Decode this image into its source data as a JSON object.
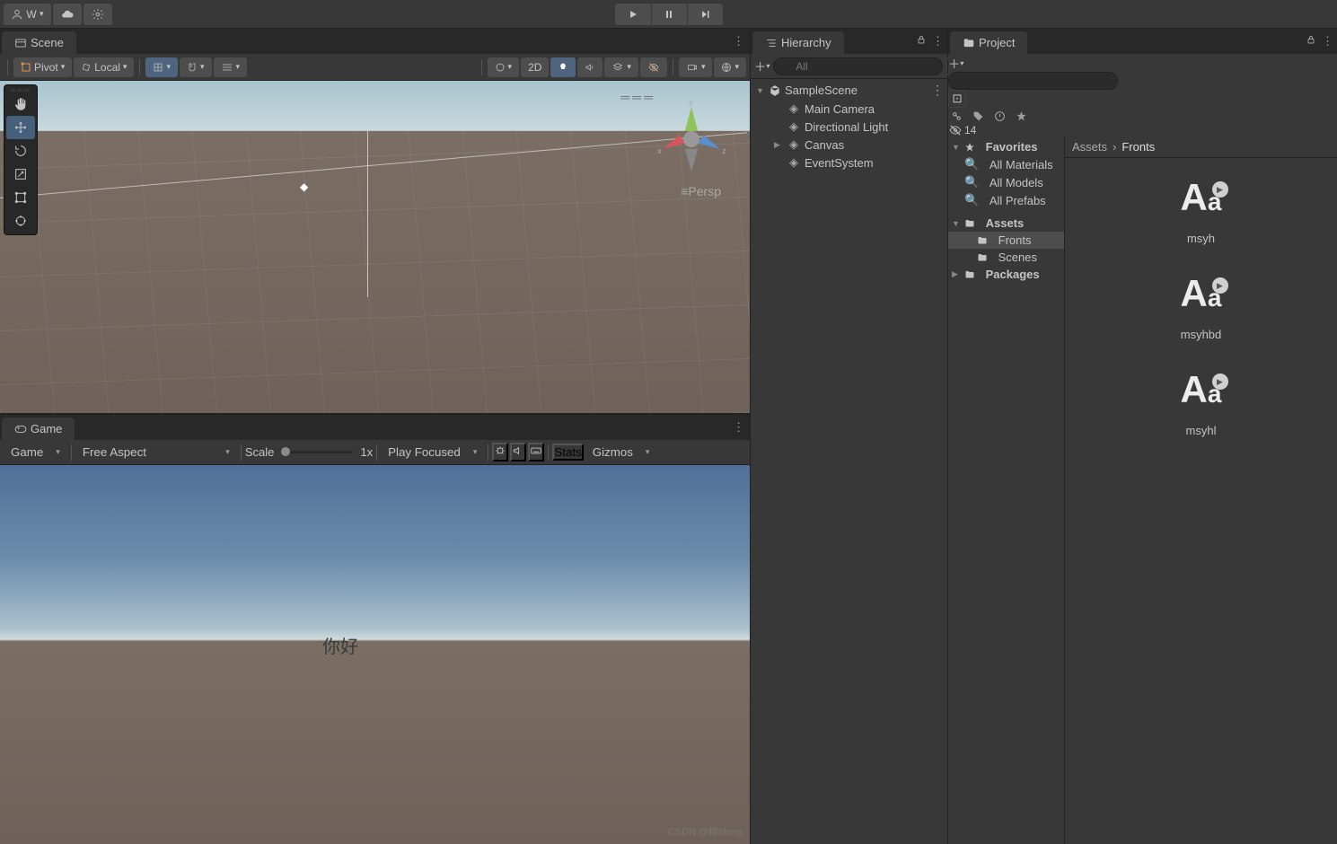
{
  "top": {
    "account_label": "W",
    "account_chevron": "▾"
  },
  "scene": {
    "tab_label": "Scene",
    "pivot_label": "Pivot",
    "local_label": "Local",
    "mode_2d": "2D",
    "persp_label": "Persp",
    "axis_x": "x",
    "axis_y": "y",
    "axis_z": "z",
    "persp_chevron": "≡"
  },
  "game": {
    "tab_label": "Game",
    "display_dd": "Game",
    "aspect_dd": "Free Aspect",
    "scale_label": "Scale",
    "scale_value": "1x",
    "play_focused": "Play Focused",
    "stats": "Stats",
    "gizmos": "Gizmos",
    "world_text": "你好",
    "watermark": "CSDN @柳nlong"
  },
  "hierarchy": {
    "title": "Hierarchy",
    "search_placeholder": "All",
    "scene_name": "SampleScene",
    "items": [
      "Main Camera",
      "Directional Light",
      "Canvas",
      "EventSystem"
    ]
  },
  "project": {
    "title": "Project",
    "search_placeholder": "",
    "hidden_count": "14",
    "tree": {
      "favorites": {
        "label": "Favorites",
        "items": [
          "All Materials",
          "All Models",
          "All Prefabs"
        ]
      },
      "assets": {
        "label": "Assets",
        "items": [
          "Fronts",
          "Scenes"
        ]
      },
      "packages": {
        "label": "Packages"
      }
    },
    "breadcrumb": {
      "root": "Assets",
      "current": "Fronts"
    },
    "files": [
      "msyh",
      "msyhbd",
      "msyhl"
    ]
  }
}
